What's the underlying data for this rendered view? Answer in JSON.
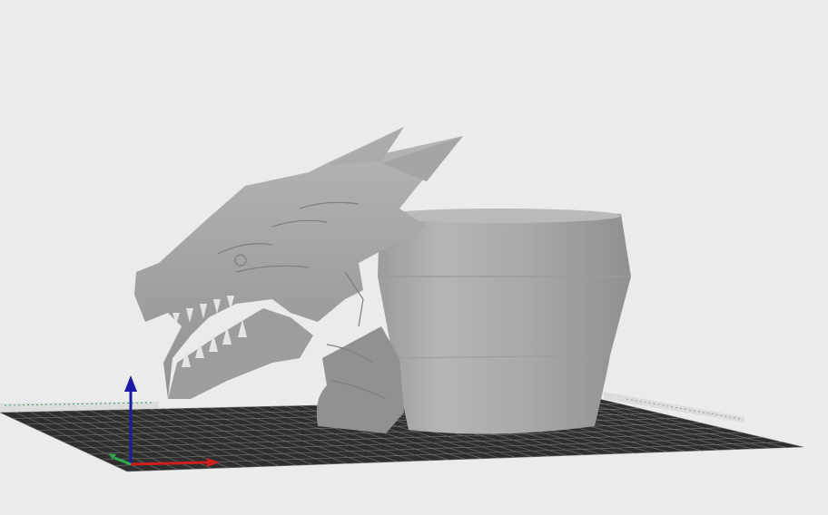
{
  "viewport": {
    "background_color": "#ebebeb",
    "model_color": "#a7a9ab",
    "grid_color": "#2e2e2e",
    "grid_line_color": "#777777"
  },
  "axes": {
    "x_color": "#cc1f1f",
    "y_color": "#2fa84f",
    "z_color": "#1b1ba6"
  },
  "objects": [
    {
      "name": "dragon-head-planter",
      "description_icon": "dragon-head-model-icon"
    },
    {
      "name": "cylindrical-pot",
      "description_icon": "pot-model-icon"
    }
  ]
}
